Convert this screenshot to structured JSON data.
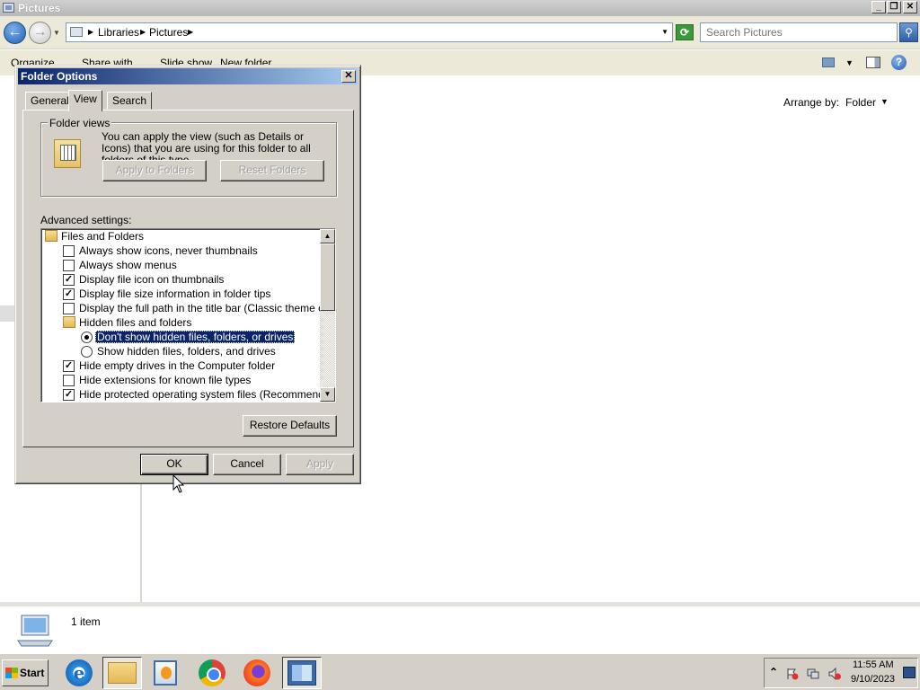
{
  "window": {
    "title": "Pictures",
    "min_label": "_",
    "max_label": "❐",
    "close_label": "✕"
  },
  "address": {
    "crumbs": [
      "Libraries",
      "Pictures"
    ],
    "search_placeholder": "Search Pictures"
  },
  "toolbar": {
    "organize": "Organize",
    "share_with": "Share with",
    "slide_show": "Slide show",
    "new_folder": "New folder"
  },
  "content": {
    "arrange_label": "Arrange by:",
    "arrange_value": "Folder"
  },
  "details": {
    "item_count": "1 item"
  },
  "taskbar": {
    "start_label": "Start",
    "time": "11:55 AM",
    "date": "9/10/2023"
  },
  "dialog": {
    "title": "Folder Options",
    "tabs": [
      "General",
      "View",
      "Search"
    ],
    "active_tab": "View",
    "folder_views": {
      "legend": "Folder views",
      "description": "You can apply the view (such as Details or Icons) that you are using for this folder to all folders of this type.",
      "apply_button": "Apply to Folders",
      "reset_button": "Reset Folders"
    },
    "advanced_label": "Advanced settings:",
    "advanced_items": [
      {
        "type": "folder",
        "label": "Files and Folders",
        "indent": 0
      },
      {
        "type": "checkbox",
        "label": "Always show icons, never thumbnails",
        "checked": false,
        "indent": 1
      },
      {
        "type": "checkbox",
        "label": "Always show menus",
        "checked": false,
        "indent": 1
      },
      {
        "type": "checkbox",
        "label": "Display file icon on thumbnails",
        "checked": true,
        "indent": 1
      },
      {
        "type": "checkbox",
        "label": "Display file size information in folder tips",
        "checked": true,
        "indent": 1
      },
      {
        "type": "checkbox",
        "label": "Display the full path in the title bar (Classic theme only)",
        "checked": false,
        "indent": 1
      },
      {
        "type": "folder",
        "label": "Hidden files and folders",
        "indent": 1
      },
      {
        "type": "radio",
        "label": "Don't show hidden files, folders, or drives",
        "checked": true,
        "selected": true,
        "indent": 2
      },
      {
        "type": "radio",
        "label": "Show hidden files, folders, and drives",
        "checked": false,
        "indent": 2
      },
      {
        "type": "checkbox",
        "label": "Hide empty drives in the Computer folder",
        "checked": true,
        "indent": 1
      },
      {
        "type": "checkbox",
        "label": "Hide extensions for known file types",
        "checked": false,
        "indent": 1
      },
      {
        "type": "checkbox",
        "label": "Hide protected operating system files (Recommended)",
        "checked": true,
        "indent": 1
      }
    ],
    "restore_button": "Restore Defaults",
    "ok_button": "OK",
    "cancel_button": "Cancel",
    "apply_button": "Apply",
    "close_label": "✕"
  }
}
